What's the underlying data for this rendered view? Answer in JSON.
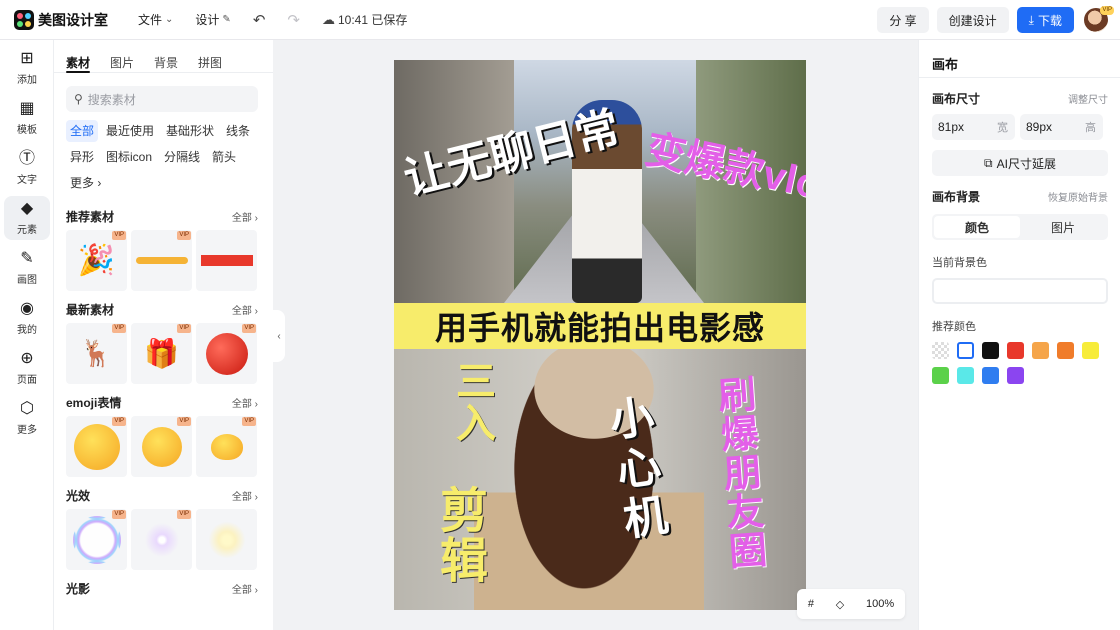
{
  "app": {
    "title": "美图设计室"
  },
  "header": {
    "menu_file": "文件",
    "menu_design": "设计",
    "save_time": "10:41",
    "save_text": "已保存",
    "share": "分 享",
    "create": "创建设计",
    "download": "下载",
    "avatar_badge": "VIP",
    "accent_color": "#1f6cf5"
  },
  "rail": [
    {
      "label": "添加",
      "icon": "plus-square-icon"
    },
    {
      "label": "模板",
      "icon": "template-icon"
    },
    {
      "label": "文字",
      "icon": "text-icon"
    },
    {
      "label": "元素",
      "icon": "shapes-icon"
    },
    {
      "label": "画图",
      "icon": "pencil-square-icon"
    },
    {
      "label": "我的",
      "icon": "user-circle-icon"
    },
    {
      "label": "页面",
      "icon": "page-plus-icon"
    },
    {
      "label": "更多",
      "icon": "cube-icon"
    }
  ],
  "panel": {
    "tabs": [
      "素材",
      "图片",
      "背景",
      "拼图"
    ],
    "search_placeholder": "搜索素材",
    "chips": [
      "全部",
      "最近使用",
      "基础形状",
      "线条",
      "异形",
      "图标icon",
      "分隔线",
      "箭头",
      "更多"
    ],
    "all_label": "全部",
    "vip": "VIP",
    "sections": [
      {
        "title": "推荐素材"
      },
      {
        "title": "最新素材"
      },
      {
        "title": "emoji表情"
      },
      {
        "title": "光效"
      },
      {
        "title": "光影"
      }
    ]
  },
  "canvas": {
    "band_text": "用手机就能拍出电影感",
    "left_text": "让无聊日常",
    "right_text": "变爆款vlog",
    "sanru": "三入",
    "jianji": "剪辑",
    "xiaoxin": "小心机",
    "shuabao": "刷爆朋友圈",
    "zoom": "100%"
  },
  "right": {
    "title": "画布",
    "size_label": "画布尺寸",
    "size_link": "调整尺寸",
    "width_value": "81px",
    "width_unit": "宽",
    "height_value": "89px",
    "height_unit": "高",
    "ai_button": "AI尺寸延展",
    "bg_label": "画布背景",
    "bg_reset": "恢复原始背景",
    "seg_color": "颜色",
    "seg_image": "图片",
    "current_bg": "当前背景色",
    "recommend": "推荐颜色",
    "swatches": [
      "transparent",
      "#ffffff",
      "#111111",
      "#e8382b",
      "#f5a54a",
      "#f07c2a",
      "#f7ec3a",
      "#5bd14a",
      "#5ae8e8",
      "#2f7df0",
      "#8b45f0"
    ]
  }
}
